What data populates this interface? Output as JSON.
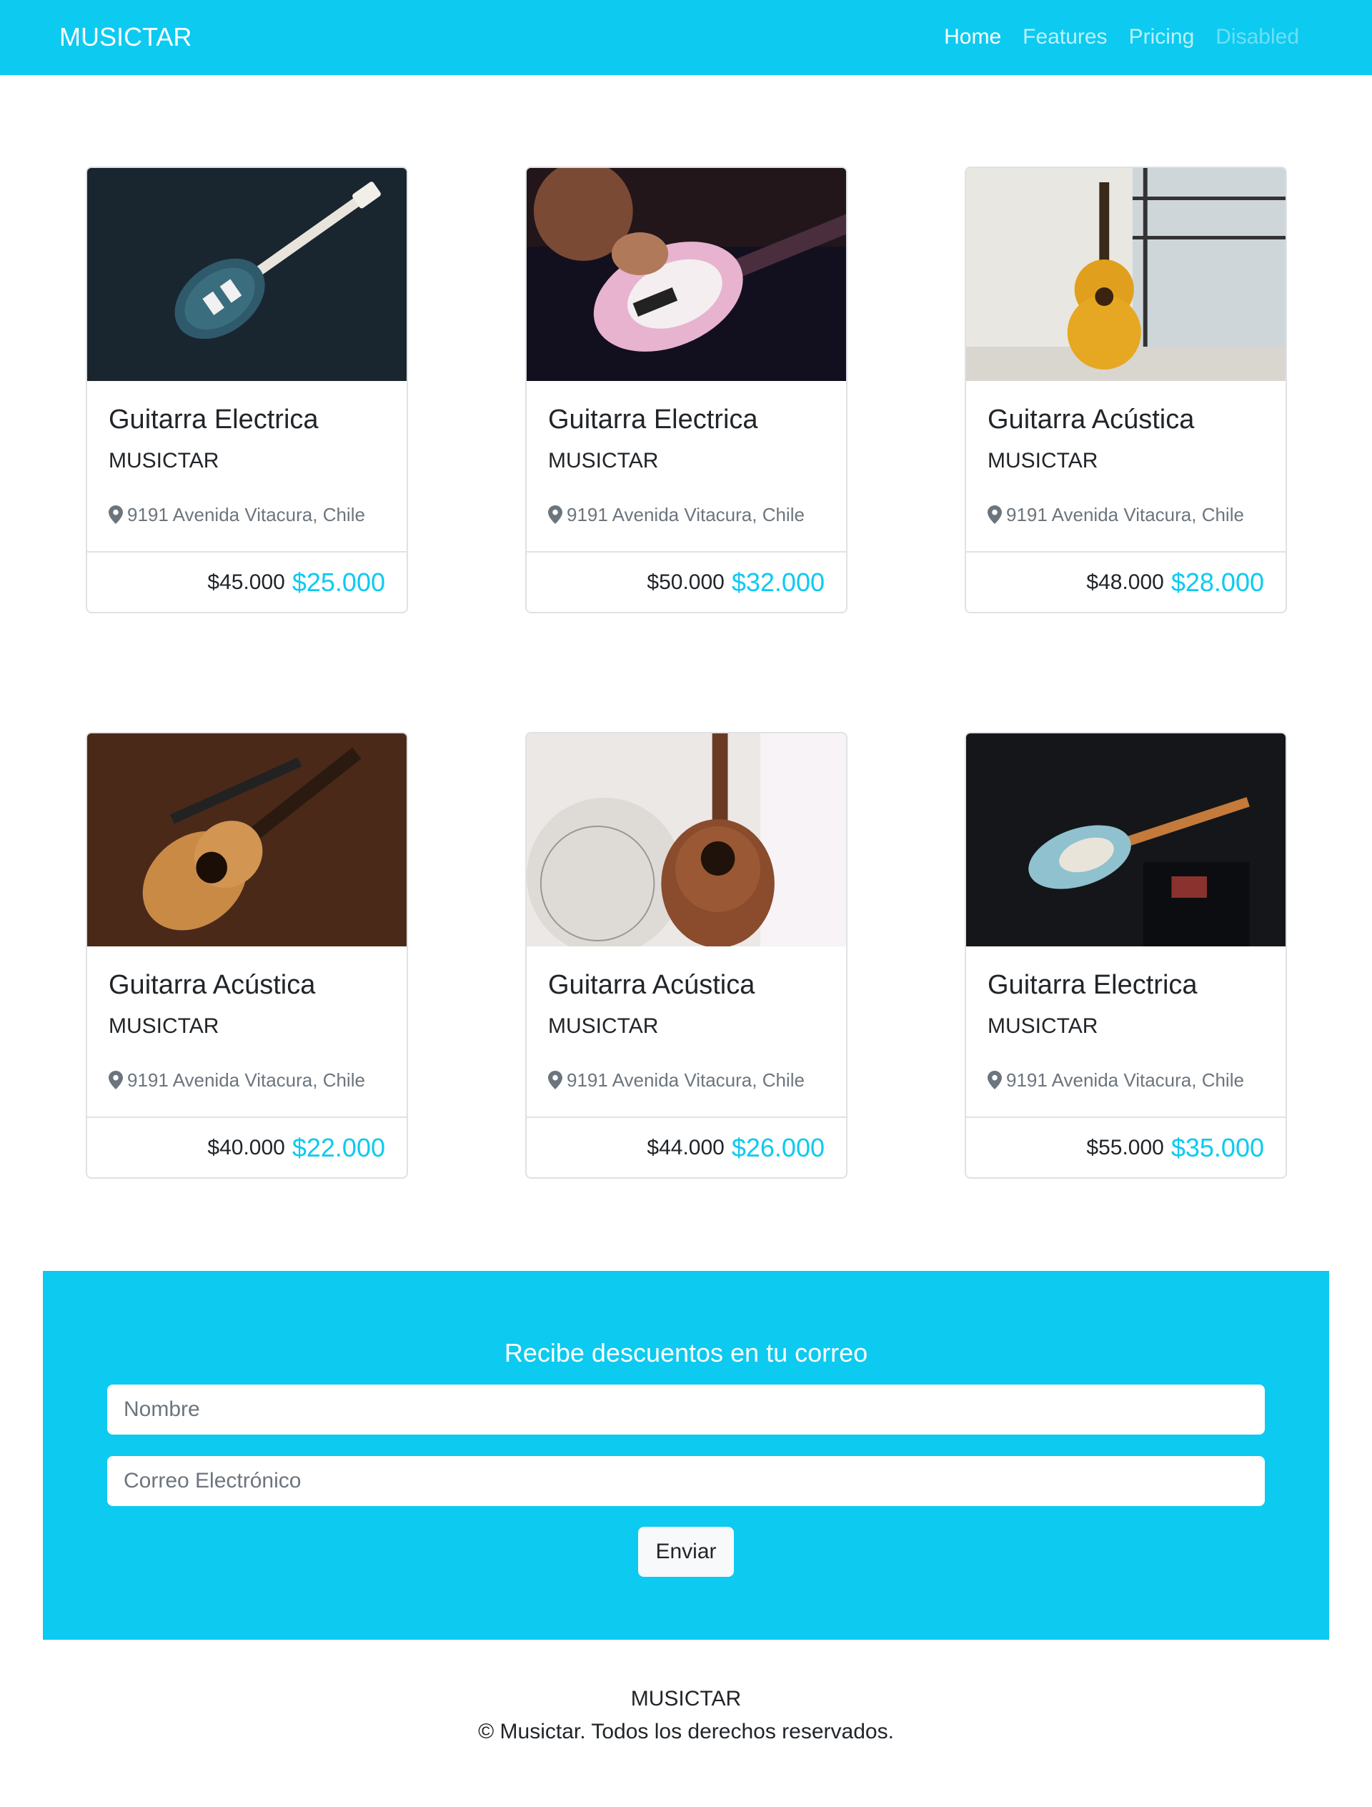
{
  "navbar": {
    "brand": "MUSICTAR",
    "links": [
      {
        "label": "Home",
        "state": "active"
      },
      {
        "label": "Features",
        "state": "normal"
      },
      {
        "label": "Pricing",
        "state": "normal"
      },
      {
        "label": "Disabled",
        "state": "disabled"
      }
    ]
  },
  "products": [
    {
      "title": "Guitarra Electrica",
      "brand": "MUSICTAR",
      "location": "9191 Avenida Vitacura, Chile",
      "old_price": "$45.000",
      "new_price": "$25.000",
      "image": "electric-guitar-on-dark-floor"
    },
    {
      "title": "Guitarra Electrica",
      "brand": "MUSICTAR",
      "location": "9191 Avenida Vitacura, Chile",
      "old_price": "$50.000",
      "new_price": "$32.000",
      "image": "pink-bass-guitar-being-played"
    },
    {
      "title": "Guitarra Acústica",
      "brand": "MUSICTAR",
      "location": "9191 Avenida Vitacura, Chile",
      "old_price": "$48.000",
      "new_price": "$28.000",
      "image": "classical-guitar-by-window"
    },
    {
      "title": "Guitarra Acústica",
      "brand": "MUSICTAR",
      "location": "9191 Avenida Vitacura, Chile",
      "old_price": "$40.000",
      "new_price": "$22.000",
      "image": "acoustic-guitar-on-wood"
    },
    {
      "title": "Guitarra Acústica",
      "brand": "MUSICTAR",
      "location": "9191 Avenida Vitacura, Chile",
      "old_price": "$44.000",
      "new_price": "$26.000",
      "image": "acoustic-guitar-with-pillow"
    },
    {
      "title": "Guitarra Electrica",
      "brand": "MUSICTAR",
      "location": "9191 Avenida Vitacura, Chile",
      "old_price": "$55.000",
      "new_price": "$35.000",
      "image": "electric-guitar-on-amp"
    }
  ],
  "newsletter": {
    "title": "Recibe descuentos en tu correo",
    "name_placeholder": "Nombre",
    "email_placeholder": "Correo Electrónico",
    "submit_label": "Enviar"
  },
  "footer": {
    "brand": "MUSICTAR",
    "copyright": "© Musictar. Todos los derechos reservados."
  },
  "colors": {
    "accent": "#0dcaf0",
    "text": "#212529",
    "muted": "#6c757d"
  }
}
